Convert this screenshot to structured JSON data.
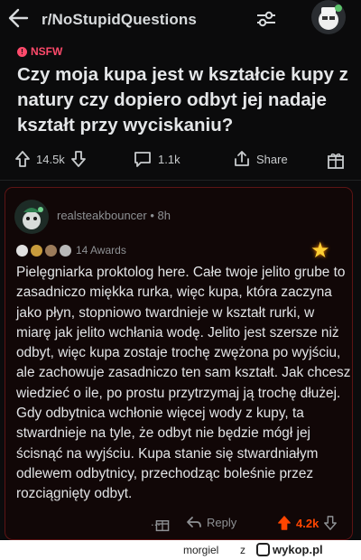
{
  "header": {
    "subreddit": "r/NoStupidQuestions",
    "icons": [
      "back-arrow-icon",
      "filter-sliders-icon",
      "user-avatar-icon"
    ]
  },
  "post": {
    "badge": "NSFW",
    "title": "Czy moja kupa jest w kształcie kupy z natury czy dopiero odbyt jej nadaje kształt przy wyciskaniu?",
    "upvotes": "14.5k",
    "comments": "1.1k",
    "share_label": "Share"
  },
  "comment": {
    "username": "realsteakbouncer",
    "separator": "•",
    "age": "8h",
    "awards_label": "14 Awards",
    "body": "Pielęgniarka proktolog here. Całe twoje jelito grube to zasadniczo miękka rurka, więc kupa, która zaczyna jako płyn, stopniowo twardnieje w kształt rurki, w miarę jak jelito wchłania wodę. Jelito jest szersze niż odbyt, więc kupa zostaje trochę zwężona po wyjściu, ale zachowuje zasadniczo ten sam kształt. Jak chcesz wiedzieć o ile, po prostu przytrzymaj ją trochę dłużej. Gdy odbytnica wchłonie więcej wody z kupy, ta stwardnieje na tyle, że odbyt nie będzie mógł jej ścisnąć na wyjściu. Kupa stanie się stwardniałym odlewem odbytnicy, przechodząc boleśnie przez rozciągnięty odbyt.",
    "reply_label": "Reply",
    "score": "4.2k",
    "more": "..."
  },
  "watermark": {
    "user": "morgiel",
    "z": "z",
    "site": "wykop.pl"
  },
  "colors": {
    "background": "#0b0b0c",
    "nsfw": "#ff4a6b",
    "comment_border": "#5c1414",
    "upvote_active": "#ff4500",
    "text": "#e2e4e6",
    "muted": "#8e9194"
  }
}
